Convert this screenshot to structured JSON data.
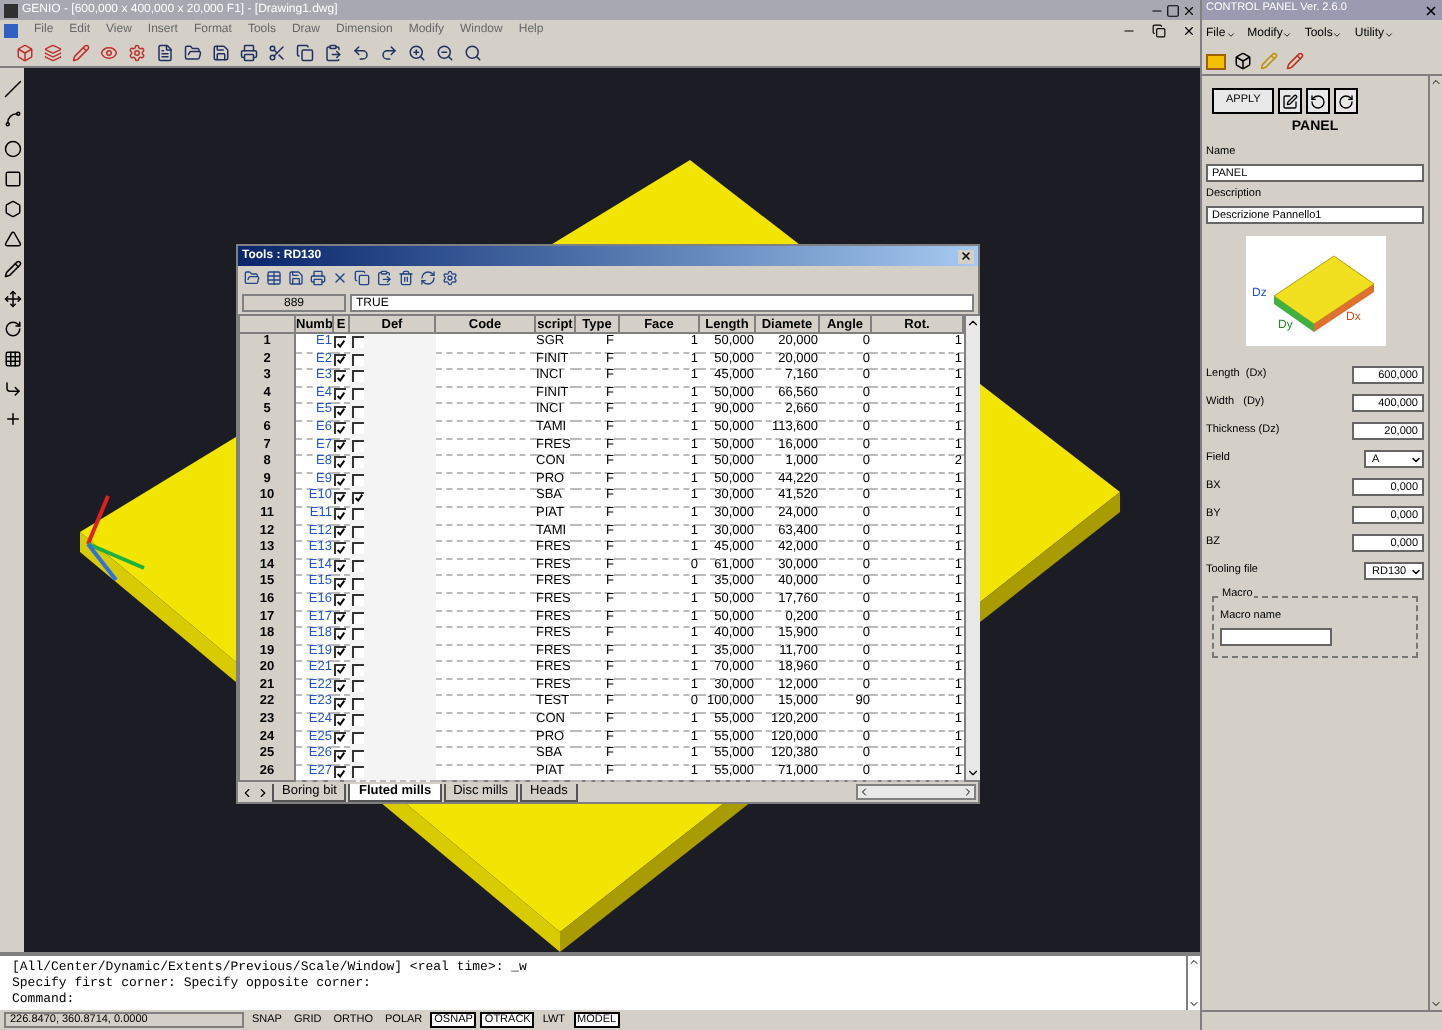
{
  "window": {
    "title": "GENIO - [600,000 x 400,000 x 20,000 F1] - [Drawing1.dwg]"
  },
  "menu": [
    "File",
    "Edit",
    "View",
    "Insert",
    "Format",
    "Tools",
    "Draw",
    "Dimension",
    "Modify",
    "Window",
    "Help"
  ],
  "tools_dialog": {
    "title": "Tools : RD130",
    "cell_ref": "889",
    "cell_value": "TRUE",
    "columns": [
      "Numb",
      "E",
      "Def",
      "Code",
      "script",
      "Type",
      "Face",
      "Length",
      "Diamete",
      "Angle",
      "Rot."
    ],
    "rows": [
      {
        "number": "1",
        "numb": "E1",
        "e_checked": true,
        "def_checked": false,
        "description": "SGR",
        "type": "F",
        "face": "1",
        "length": "50,000",
        "diameter": "20,000",
        "angle": "0",
        "rot": "1"
      },
      {
        "number": "2",
        "numb": "E2",
        "e_checked": true,
        "def_checked": false,
        "description": "FINIT",
        "type": "F",
        "face": "1",
        "length": "50,000",
        "diameter": "20,000",
        "angle": "0",
        "rot": "1"
      },
      {
        "number": "3",
        "numb": "E3",
        "e_checked": true,
        "def_checked": false,
        "description": "INCI",
        "type": "F",
        "face": "1",
        "length": "45,000",
        "diameter": "7,160",
        "angle": "0",
        "rot": "1"
      },
      {
        "number": "4",
        "numb": "E4",
        "e_checked": true,
        "def_checked": false,
        "description": "FINIT",
        "type": "F",
        "face": "1",
        "length": "50,000",
        "diameter": "66,560",
        "angle": "0",
        "rot": "1"
      },
      {
        "number": "5",
        "numb": "E5",
        "e_checked": true,
        "def_checked": false,
        "description": "INCI",
        "type": "F",
        "face": "1",
        "length": "90,000",
        "diameter": "2,660",
        "angle": "0",
        "rot": "1"
      },
      {
        "number": "6",
        "numb": "E6",
        "e_checked": true,
        "def_checked": false,
        "description": "TAMI",
        "type": "F",
        "face": "1",
        "length": "50,000",
        "diameter": "113,600",
        "angle": "0",
        "rot": "1"
      },
      {
        "number": "7",
        "numb": "E7",
        "e_checked": true,
        "def_checked": false,
        "description": "FRES",
        "type": "F",
        "face": "1",
        "length": "50,000",
        "diameter": "16,000",
        "angle": "0",
        "rot": "1"
      },
      {
        "number": "8",
        "numb": "E8",
        "e_checked": true,
        "def_checked": false,
        "description": "CON",
        "type": "F",
        "face": "1",
        "length": "50,000",
        "diameter": "1,000",
        "angle": "0",
        "rot": "2"
      },
      {
        "number": "9",
        "numb": "E9",
        "e_checked": true,
        "def_checked": false,
        "description": "PRO",
        "type": "F",
        "face": "1",
        "length": "50,000",
        "diameter": "44,220",
        "angle": "0",
        "rot": "1"
      },
      {
        "number": "10",
        "numb": "E10",
        "e_checked": true,
        "def_checked": true,
        "description": "SBA",
        "type": "F",
        "face": "1",
        "length": "30,000",
        "diameter": "41,520",
        "angle": "0",
        "rot": "1"
      },
      {
        "number": "11",
        "numb": "E11",
        "e_checked": true,
        "def_checked": false,
        "description": "PIAT",
        "type": "F",
        "face": "1",
        "length": "30,000",
        "diameter": "24,000",
        "angle": "0",
        "rot": "1"
      },
      {
        "number": "12",
        "numb": "E12",
        "e_checked": true,
        "def_checked": false,
        "description": "TAMI",
        "type": "F",
        "face": "1",
        "length": "30,000",
        "diameter": "63,400",
        "angle": "0",
        "rot": "1"
      },
      {
        "number": "13",
        "numb": "E13",
        "e_checked": true,
        "def_checked": false,
        "description": "FRES",
        "type": "F",
        "face": "1",
        "length": "45,000",
        "diameter": "42,000",
        "angle": "0",
        "rot": "1"
      },
      {
        "number": "14",
        "numb": "E14",
        "e_checked": true,
        "def_checked": false,
        "description": "FRES",
        "type": "F",
        "face": "0",
        "length": "61,000",
        "diameter": "30,000",
        "angle": "0",
        "rot": "1"
      },
      {
        "number": "15",
        "numb": "E15",
        "e_checked": true,
        "def_checked": false,
        "description": "FRES",
        "type": "F",
        "face": "1",
        "length": "35,000",
        "diameter": "40,000",
        "angle": "0",
        "rot": "1"
      },
      {
        "number": "16",
        "numb": "E16",
        "e_checked": true,
        "def_checked": false,
        "description": "FRES",
        "type": "F",
        "face": "1",
        "length": "50,000",
        "diameter": "17,760",
        "angle": "0",
        "rot": "1"
      },
      {
        "number": "17",
        "numb": "E17",
        "e_checked": true,
        "def_checked": false,
        "description": "FRES",
        "type": "F",
        "face": "1",
        "length": "50,000",
        "diameter": "0,200",
        "angle": "0",
        "rot": "1"
      },
      {
        "number": "18",
        "numb": "E18",
        "e_checked": true,
        "def_checked": false,
        "description": "FRES",
        "type": "F",
        "face": "1",
        "length": "40,000",
        "diameter": "15,900",
        "angle": "0",
        "rot": "1"
      },
      {
        "number": "19",
        "numb": "E19",
        "e_checked": true,
        "def_checked": false,
        "description": "FRES",
        "type": "F",
        "face": "1",
        "length": "35,000",
        "diameter": "11,700",
        "angle": "0",
        "rot": "1"
      },
      {
        "number": "20",
        "numb": "E21",
        "e_checked": true,
        "def_checked": false,
        "description": "FRES",
        "type": "F",
        "face": "1",
        "length": "70,000",
        "diameter": "18,960",
        "angle": "0",
        "rot": "1"
      },
      {
        "number": "21",
        "numb": "E22",
        "e_checked": true,
        "def_checked": false,
        "description": "FRES",
        "type": "F",
        "face": "1",
        "length": "30,000",
        "diameter": "12,000",
        "angle": "0",
        "rot": "1"
      },
      {
        "number": "22",
        "numb": "E23",
        "e_checked": true,
        "def_checked": false,
        "description": "TEST",
        "type": "F",
        "face": "0",
        "length": "100,000",
        "diameter": "15,000",
        "angle": "90",
        "rot": "1"
      },
      {
        "number": "23",
        "numb": "E24",
        "e_checked": true,
        "def_checked": false,
        "description": "CON",
        "type": "F",
        "face": "1",
        "length": "55,000",
        "diameter": "120,200",
        "angle": "0",
        "rot": "1"
      },
      {
        "number": "24",
        "numb": "E25",
        "e_checked": true,
        "def_checked": false,
        "description": "PRO",
        "type": "F",
        "face": "1",
        "length": "55,000",
        "diameter": "120,000",
        "angle": "0",
        "rot": "1"
      },
      {
        "number": "25",
        "numb": "E26",
        "e_checked": true,
        "def_checked": false,
        "description": "SBA",
        "type": "F",
        "face": "1",
        "length": "55,000",
        "diameter": "120,380",
        "angle": "0",
        "rot": "1"
      },
      {
        "number": "26",
        "numb": "E27",
        "e_checked": true,
        "def_checked": false,
        "description": "PIAT",
        "type": "F",
        "face": "1",
        "length": "55,000",
        "diameter": "71,000",
        "angle": "0",
        "rot": "1"
      }
    ],
    "tabs": [
      {
        "label": "Boring bit",
        "selected": false
      },
      {
        "label": "Fluted mills",
        "selected": true
      },
      {
        "label": "Disc mills",
        "selected": false
      },
      {
        "label": "Heads",
        "selected": false
      }
    ]
  },
  "command_line": {
    "lines": [
      "[All/Center/Dynamic/Extents/Previous/Scale/Window] <real time>: _w",
      "Specify first corner: Specify opposite corner:",
      "Command:"
    ]
  },
  "status_bar": {
    "coordinates": "226.8470, 360.8714, 0.0000",
    "toggles": [
      {
        "label": "SNAP",
        "on": false
      },
      {
        "label": "GRID",
        "on": false
      },
      {
        "label": "ORTHO",
        "on": false
      },
      {
        "label": "POLAR",
        "on": false
      },
      {
        "label": "OSNAP",
        "on": true
      },
      {
        "label": "OTRACK",
        "on": true
      },
      {
        "label": "LWT",
        "on": false
      },
      {
        "label": "MODEL",
        "on": true
      }
    ]
  },
  "control_panel": {
    "title": "CONTROL PANEL Ver. 2.6.0",
    "menu": [
      "File",
      "Modify",
      "Tools",
      "Utility"
    ],
    "apply_label": "APPLY",
    "heading": "PANEL",
    "name_label": "Name",
    "name_value": "PANEL",
    "description_label": "Description",
    "description_value": "Descrizione Pannello1",
    "diagram_labels": {
      "dx": "Dx",
      "dy": "Dy",
      "dz": "Dz"
    },
    "fields": [
      {
        "label": "Length  (Dx)",
        "value": "600,000",
        "kind": "text"
      },
      {
        "label": "Width   (Dy)",
        "value": "400,000",
        "kind": "text"
      },
      {
        "label": "Thickness (Dz)",
        "value": "20,000",
        "kind": "text"
      },
      {
        "label": "Field",
        "value": "A",
        "kind": "select"
      },
      {
        "label": "BX",
        "value": "0,000",
        "kind": "text"
      },
      {
        "label": "BY",
        "value": "0,000",
        "kind": "text"
      },
      {
        "label": "BZ",
        "value": "0,000",
        "kind": "text"
      },
      {
        "label": "Tooling file",
        "value": "RD130",
        "kind": "select"
      }
    ],
    "macro": {
      "title": "Macro",
      "label": "Macro name"
    }
  }
}
